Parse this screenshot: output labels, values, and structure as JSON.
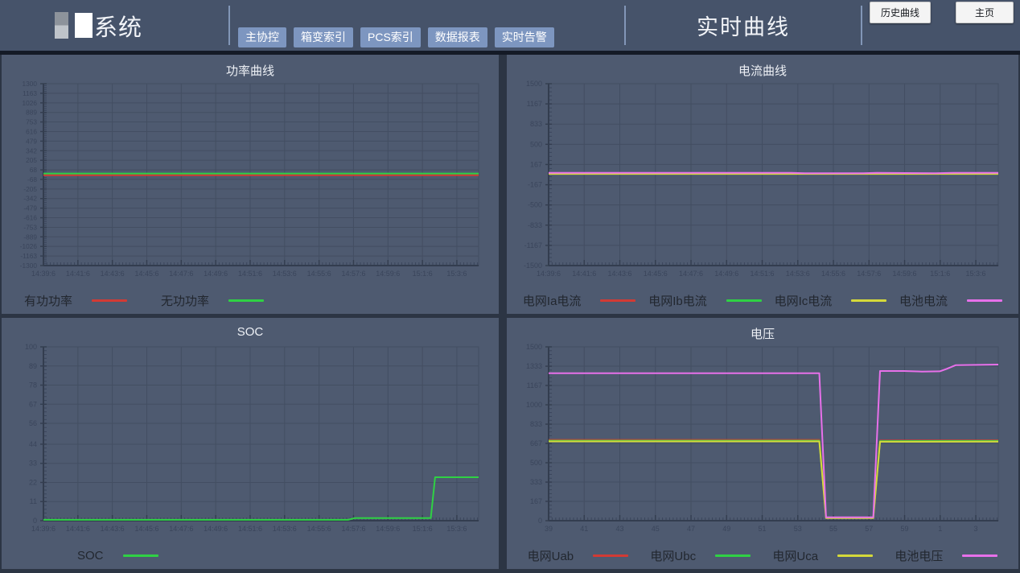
{
  "header": {
    "logo_text": "系统",
    "nav": [
      {
        "label": "主协控"
      },
      {
        "label": "箱变索引"
      },
      {
        "label": "PCS索引"
      },
      {
        "label": "数据报表"
      },
      {
        "label": "实时告警"
      }
    ],
    "page_title": "实时曲线",
    "actions": [
      {
        "label": "历史曲线"
      },
      {
        "label": "主页"
      }
    ]
  },
  "colors": {
    "header_bg": "#46536a",
    "panel_bg": "#4e5a70",
    "page_bg": "#2c3544",
    "nav_button_bg": "#7d96c0",
    "grid_line": "#434e62",
    "axis_line": "#333d4f",
    "tick_text": "#3a455b",
    "series_red": "#d23a34",
    "series_green": "#2fd144",
    "series_yellow": "#d5d93a",
    "series_magenta": "#e770ea"
  },
  "chart_data": [
    {
      "type": "line",
      "title": "功率曲线",
      "ylim": [
        -1300,
        1300
      ],
      "yticks": [
        1300,
        1163,
        1026,
        889,
        753,
        616,
        479,
        342,
        205,
        68,
        -68,
        -205,
        -342,
        -479,
        -616,
        -753,
        -889,
        -1026,
        -1163,
        -1300
      ],
      "xlabels": [
        "14:39:6",
        "14:41:6",
        "14:43:6",
        "14:45:6",
        "14:47:6",
        "14:49:6",
        "14:51:6",
        "14:53:6",
        "14:55:6",
        "14:57:6",
        "14:59:6",
        "15:1:6",
        "15:3:6"
      ],
      "grid": true,
      "legend_position": "bottom-left",
      "series": [
        {
          "name": "有功功率",
          "color": "#d23a34",
          "points": [
            [
              0,
              -8
            ],
            [
              1,
              -8
            ]
          ]
        },
        {
          "name": "无功功率",
          "color": "#2fd144",
          "points": [
            [
              0,
              16
            ],
            [
              1,
              16
            ]
          ]
        }
      ]
    },
    {
      "type": "line",
      "title": "电流曲线",
      "ylim": [
        -1500,
        1500
      ],
      "yticks": [
        1500,
        1167,
        833,
        500,
        167,
        -167,
        -500,
        -833,
        -1167,
        -1500
      ],
      "xlabels": [
        "14:39:6",
        "14:41:6",
        "14:43:6",
        "14:45:6",
        "14:47:6",
        "14:49:6",
        "14:51:6",
        "14:53:6",
        "14:55:6",
        "14:57:6",
        "14:59:6",
        "15:1:6",
        "15:3:6"
      ],
      "grid": true,
      "legend_position": "bottom-spread",
      "series": [
        {
          "name": "电网Ia电流",
          "color": "#d23a34",
          "points": [
            [
              0,
              16
            ],
            [
              1,
              16
            ]
          ]
        },
        {
          "name": "电网Ib电流",
          "color": "#2fd144",
          "points": [
            [
              0,
              16
            ],
            [
              1,
              16
            ]
          ]
        },
        {
          "name": "电网Ic电流",
          "color": "#d5d93a",
          "points": [
            [
              0,
              12
            ],
            [
              1,
              12
            ]
          ]
        },
        {
          "name": "电池电流",
          "color": "#e770ea",
          "points": [
            [
              0,
              30
            ],
            [
              0.54,
              30
            ],
            [
              0.57,
              22
            ],
            [
              0.7,
              22
            ],
            [
              0.73,
              30
            ],
            [
              0.86,
              24
            ],
            [
              0.9,
              30
            ],
            [
              1,
              30
            ]
          ]
        }
      ]
    },
    {
      "type": "line",
      "title": "SOC",
      "ylim": [
        0,
        100
      ],
      "yticks": [
        100,
        89,
        78,
        67,
        56,
        44,
        33,
        22,
        11,
        0
      ],
      "xlabels": [
        "14:39:6",
        "14:41:6",
        "14:43:6",
        "14:45:6",
        "14:47:6",
        "14:49:6",
        "14:51:6",
        "14:53:6",
        "14:55:6",
        "14:57:6",
        "14:59:6",
        "15:1:6",
        "15:3:6"
      ],
      "grid": true,
      "legend_position": "bottom-left",
      "series": [
        {
          "name": "SOC",
          "color": "#2fd144",
          "points": [
            [
              0,
              0.5
            ],
            [
              0.7,
              0.5
            ],
            [
              0.715,
              1.5
            ],
            [
              0.89,
              1.5
            ],
            [
              0.9,
              25
            ],
            [
              1,
              25
            ]
          ]
        }
      ]
    },
    {
      "type": "line",
      "title": "电压",
      "ylim": [
        0,
        1500
      ],
      "yticks": [
        1500,
        1333,
        1167,
        1000,
        833,
        667,
        500,
        333,
        167,
        0
      ],
      "xlabels": [
        "39",
        "41",
        "43",
        "45",
        "47",
        "49",
        "51",
        "53",
        "55",
        "57",
        "59",
        "1",
        "3"
      ],
      "grid": true,
      "legend_position": "bottom-spread",
      "series": [
        {
          "name": "电网Uab",
          "color": "#d23a34",
          "points": [
            [
              0,
              697
            ],
            [
              0.602,
              697
            ],
            [
              0.617,
              28
            ],
            [
              0.722,
              28
            ],
            [
              0.737,
              692
            ],
            [
              1,
              694
            ]
          ]
        },
        {
          "name": "电网Ubc",
          "color": "#2fd144",
          "points": [
            [
              0,
              690
            ],
            [
              0.602,
              690
            ],
            [
              0.617,
              25
            ],
            [
              0.722,
              25
            ],
            [
              0.737,
              687
            ],
            [
              1,
              688
            ]
          ]
        },
        {
          "name": "电网Uca",
          "color": "#d5d93a",
          "points": [
            [
              0,
              684
            ],
            [
              0.602,
              684
            ],
            [
              0.617,
              22
            ],
            [
              0.722,
              22
            ],
            [
              0.737,
              681
            ],
            [
              1,
              682
            ]
          ]
        },
        {
          "name": "电池电压",
          "color": "#e770ea",
          "points": [
            [
              0,
              1272
            ],
            [
              0.602,
              1272
            ],
            [
              0.617,
              30
            ],
            [
              0.722,
              30
            ],
            [
              0.737,
              1292
            ],
            [
              0.79,
              1292
            ],
            [
              0.83,
              1287
            ],
            [
              0.87,
              1289
            ],
            [
              0.885,
              1310
            ],
            [
              0.905,
              1342
            ],
            [
              1,
              1347
            ]
          ]
        }
      ]
    }
  ]
}
